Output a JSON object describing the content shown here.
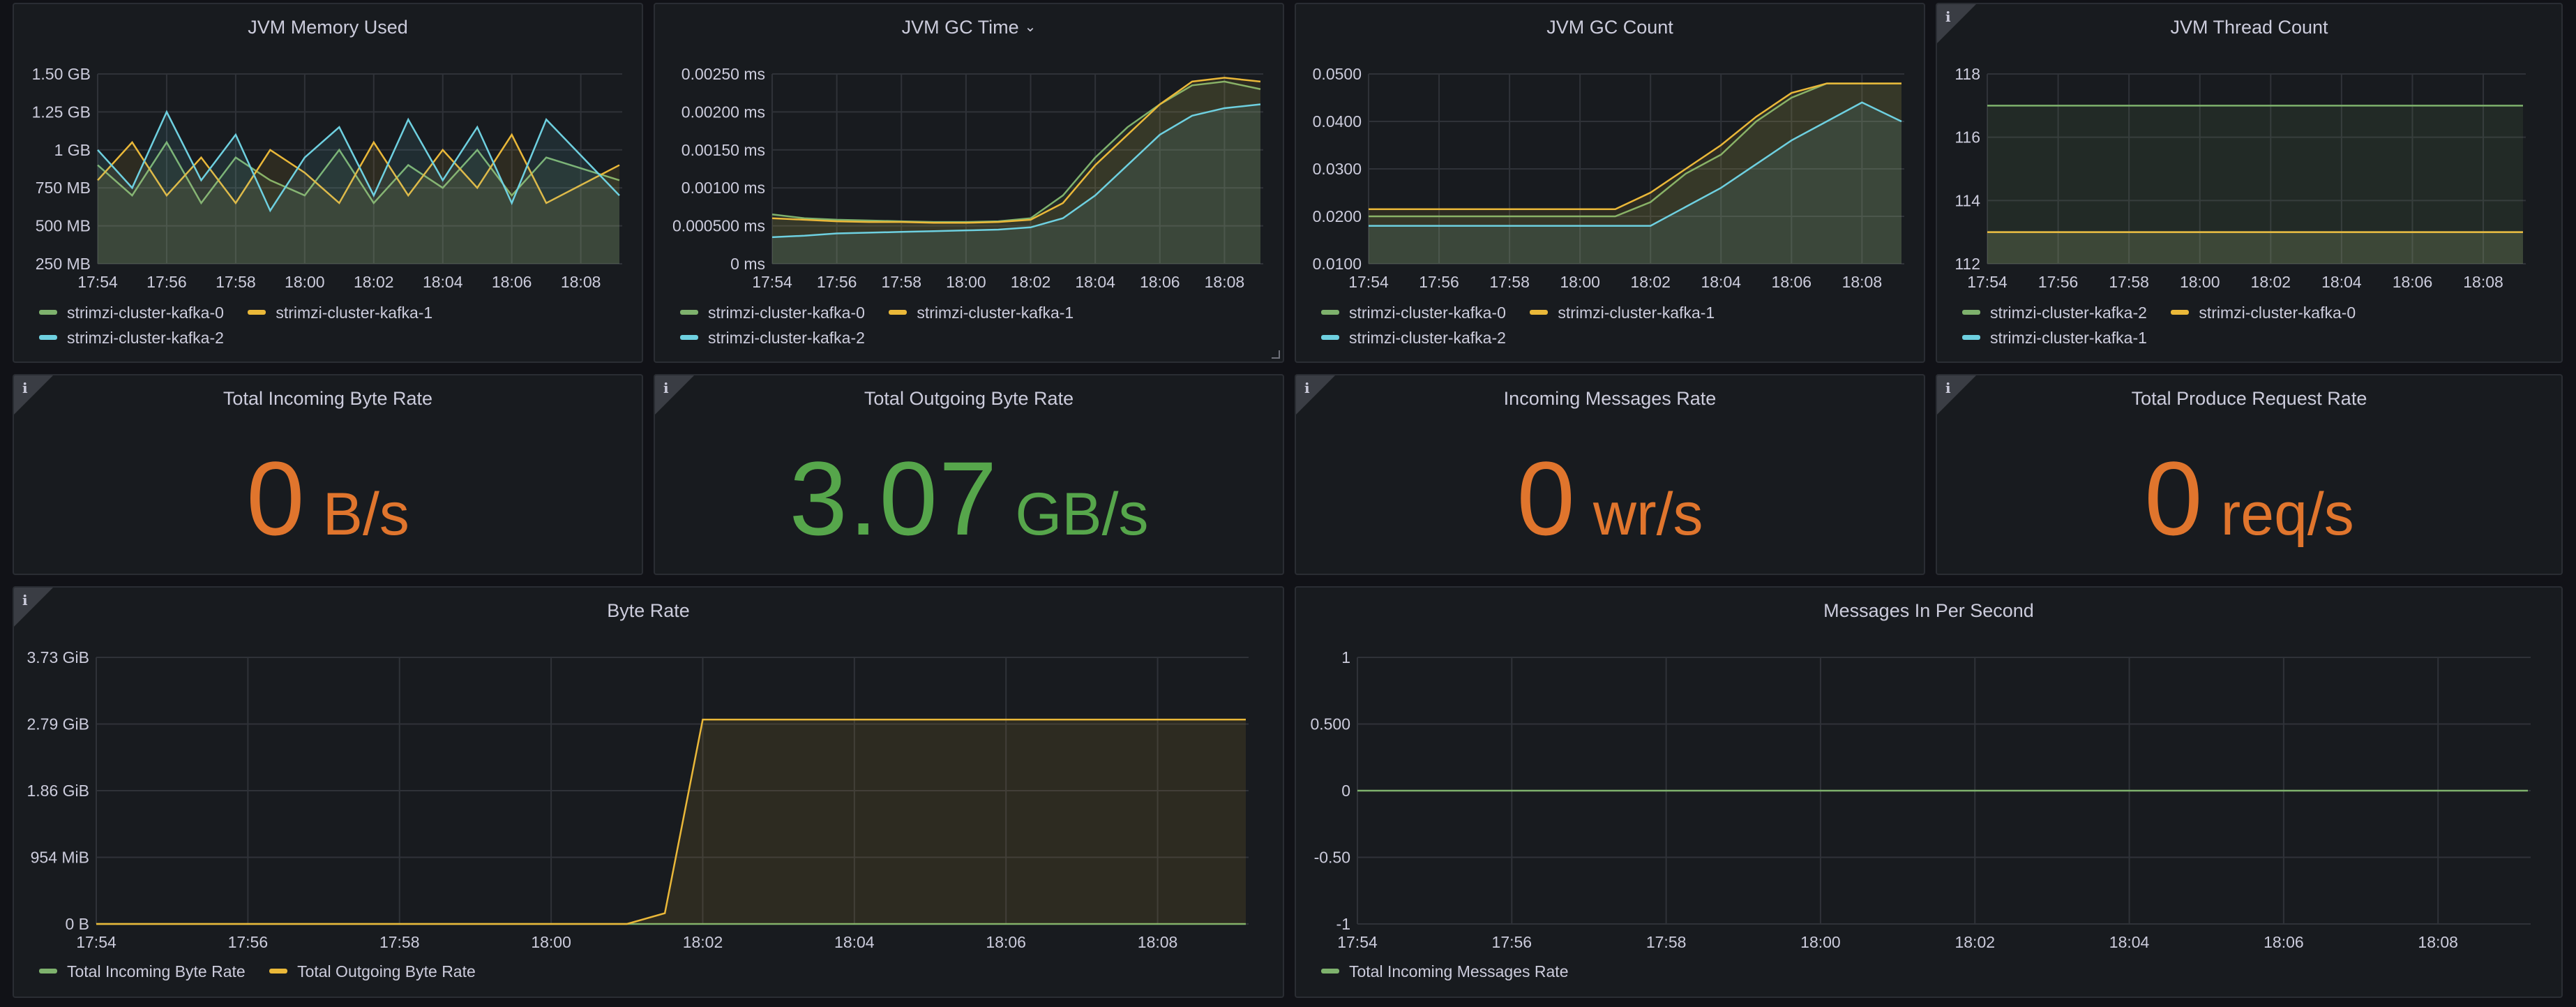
{
  "colors": {
    "green": "#7eb26d",
    "yellow": "#eab839",
    "blue": "#6ed0e0",
    "orange": "#e0752d",
    "stat_green": "#56a64b"
  },
  "panels": {
    "jvm_memory": {
      "title": "JVM Memory Used",
      "yticks": [
        "1.50 GB",
        "1.25 GB",
        "1 GB",
        "750 MB",
        "500 MB",
        "250 MB"
      ],
      "xticks": [
        "17:54",
        "17:56",
        "17:58",
        "18:00",
        "18:02",
        "18:04",
        "18:06",
        "18:08"
      ],
      "legend": [
        "strimzi-cluster-kafka-0",
        "strimzi-cluster-kafka-1",
        "strimzi-cluster-kafka-2"
      ]
    },
    "jvm_gc_time": {
      "title": "JVM GC Time",
      "yticks": [
        "0.00250 ms",
        "0.00200 ms",
        "0.00150 ms",
        "0.00100 ms",
        "0.000500 ms",
        "0 ms"
      ],
      "xticks": [
        "17:54",
        "17:56",
        "17:58",
        "18:00",
        "18:02",
        "18:04",
        "18:06",
        "18:08"
      ],
      "legend": [
        "strimzi-cluster-kafka-0",
        "strimzi-cluster-kafka-1",
        "strimzi-cluster-kafka-2"
      ]
    },
    "jvm_gc_count": {
      "title": "JVM GC Count",
      "yticks": [
        "0.0500",
        "0.0400",
        "0.0300",
        "0.0200",
        "0.0100"
      ],
      "xticks": [
        "17:54",
        "17:56",
        "17:58",
        "18:00",
        "18:02",
        "18:04",
        "18:06",
        "18:08"
      ],
      "legend": [
        "strimzi-cluster-kafka-0",
        "strimzi-cluster-kafka-1",
        "strimzi-cluster-kafka-2"
      ]
    },
    "jvm_thread_count": {
      "title": "JVM Thread Count",
      "yticks": [
        "118",
        "116",
        "114",
        "112"
      ],
      "xticks": [
        "17:54",
        "17:56",
        "17:58",
        "18:00",
        "18:02",
        "18:04",
        "18:06",
        "18:08"
      ],
      "legend": [
        "strimzi-cluster-kafka-2",
        "strimzi-cluster-kafka-0",
        "strimzi-cluster-kafka-1"
      ]
    },
    "total_incoming_byte_rate": {
      "title": "Total Incoming Byte Rate",
      "value": "0",
      "unit": "B/s"
    },
    "total_outgoing_byte_rate": {
      "title": "Total Outgoing Byte Rate",
      "value": "3.07",
      "unit": "GB/s"
    },
    "incoming_messages_rate": {
      "title": "Incoming Messages Rate",
      "value": "0",
      "unit": "wr/s"
    },
    "total_produce_request_rate": {
      "title": "Total Produce Request Rate",
      "value": "0",
      "unit": "req/s"
    },
    "byte_rate": {
      "title": "Byte Rate",
      "yticks": [
        "3.73 GiB",
        "2.79 GiB",
        "1.86 GiB",
        "954 MiB",
        "0 B"
      ],
      "xticks": [
        "17:54",
        "17:56",
        "17:58",
        "18:00",
        "18:02",
        "18:04",
        "18:06",
        "18:08"
      ],
      "legend": [
        "Total Incoming Byte Rate",
        "Total Outgoing Byte Rate"
      ]
    },
    "messages_in_per_second": {
      "title": "Messages In Per Second",
      "yticks": [
        "1",
        "0.500",
        "0",
        "-0.50",
        "-1"
      ],
      "xticks": [
        "17:54",
        "17:56",
        "17:58",
        "18:00",
        "18:02",
        "18:04",
        "18:06",
        "18:08"
      ],
      "legend": [
        "Total Incoming Messages Rate"
      ]
    }
  },
  "chart_data": [
    {
      "type": "line",
      "title": "JVM Memory Used",
      "x": [
        "17:54",
        "17:55",
        "17:56",
        "17:57",
        "17:58",
        "17:59",
        "18:00",
        "18:01",
        "18:02",
        "18:03",
        "18:04",
        "18:05",
        "18:06",
        "18:07",
        "18:08"
      ],
      "ylim": [
        250,
        1500
      ],
      "ylabel": "MB",
      "series": [
        {
          "name": "strimzi-cluster-kafka-0",
          "values": [
            900,
            700,
            1050,
            650,
            950,
            800,
            700,
            1000,
            650,
            900,
            750,
            1000,
            700,
            950,
            800
          ]
        },
        {
          "name": "strimzi-cluster-kafka-1",
          "values": [
            800,
            1050,
            700,
            950,
            650,
            1000,
            850,
            650,
            1050,
            700,
            1000,
            750,
            1100,
            650,
            900
          ]
        },
        {
          "name": "strimzi-cluster-kafka-2",
          "values": [
            1000,
            750,
            1250,
            800,
            1100,
            600,
            950,
            1150,
            700,
            1200,
            800,
            1150,
            650,
            1200,
            700
          ]
        }
      ]
    },
    {
      "type": "line",
      "title": "JVM GC Time",
      "x": [
        "17:54",
        "17:55",
        "17:56",
        "17:57",
        "17:58",
        "17:59",
        "18:00",
        "18:01",
        "18:02",
        "18:03",
        "18:04",
        "18:05",
        "18:06",
        "18:07",
        "18:08",
        "18:09"
      ],
      "ylim": [
        0,
        0.0025
      ],
      "series": [
        {
          "name": "strimzi-cluster-kafka-0",
          "values": [
            0.00065,
            0.0006,
            0.00058,
            0.00057,
            0.00056,
            0.00055,
            0.00055,
            0.00056,
            0.0006,
            0.0009,
            0.0014,
            0.0018,
            0.0021,
            0.00235,
            0.0024,
            0.0023
          ]
        },
        {
          "name": "strimzi-cluster-kafka-1",
          "values": [
            0.0006,
            0.00058,
            0.00056,
            0.00055,
            0.00055,
            0.00054,
            0.00054,
            0.00055,
            0.00058,
            0.0008,
            0.0013,
            0.0017,
            0.0021,
            0.0024,
            0.00245,
            0.0024
          ]
        },
        {
          "name": "strimzi-cluster-kafka-2",
          "values": [
            0.00035,
            0.00037,
            0.0004,
            0.00041,
            0.00042,
            0.00043,
            0.00044,
            0.00045,
            0.00048,
            0.0006,
            0.0009,
            0.0013,
            0.0017,
            0.00195,
            0.00205,
            0.0021
          ]
        }
      ]
    },
    {
      "type": "line",
      "title": "JVM GC Count",
      "x": [
        "17:54",
        "17:55",
        "17:56",
        "17:57",
        "17:58",
        "17:59",
        "18:00",
        "18:01",
        "18:02",
        "18:03",
        "18:04",
        "18:05",
        "18:06",
        "18:07",
        "18:08",
        "18:09"
      ],
      "ylim": [
        0.01,
        0.05
      ],
      "series": [
        {
          "name": "strimzi-cluster-kafka-0",
          "values": [
            0.02,
            0.02,
            0.02,
            0.02,
            0.02,
            0.02,
            0.02,
            0.02,
            0.023,
            0.029,
            0.033,
            0.04,
            0.045,
            0.048,
            0.048,
            0.048
          ]
        },
        {
          "name": "strimzi-cluster-kafka-1",
          "values": [
            0.0215,
            0.0215,
            0.0215,
            0.0215,
            0.0215,
            0.0215,
            0.0215,
            0.0215,
            0.025,
            0.03,
            0.035,
            0.041,
            0.046,
            0.048,
            0.048,
            0.048
          ]
        },
        {
          "name": "strimzi-cluster-kafka-2",
          "values": [
            0.018,
            0.018,
            0.018,
            0.018,
            0.018,
            0.018,
            0.018,
            0.018,
            0.018,
            0.022,
            0.026,
            0.031,
            0.036,
            0.04,
            0.044,
            0.04
          ]
        }
      ]
    },
    {
      "type": "line",
      "title": "JVM Thread Count",
      "x": [
        "17:54",
        "18:09"
      ],
      "ylim": [
        112,
        118
      ],
      "series": [
        {
          "name": "strimzi-cluster-kafka-2",
          "values": [
            113,
            113
          ]
        },
        {
          "name": "strimzi-cluster-kafka-0",
          "values": [
            117,
            117
          ]
        },
        {
          "name": "strimzi-cluster-kafka-1",
          "values": [
            113,
            113
          ]
        }
      ]
    },
    {
      "type": "line",
      "title": "Byte Rate",
      "x": [
        "17:54",
        "17:56",
        "17:58",
        "18:00",
        "18:01",
        "18:01.5",
        "18:02",
        "18:03",
        "18:04",
        "18:05",
        "18:06",
        "18:07",
        "18:08",
        "18:09"
      ],
      "ylim": [
        0,
        3.73
      ],
      "ylabel": "GiB",
      "series": [
        {
          "name": "Total Incoming Byte Rate",
          "values": [
            0,
            0,
            0,
            0,
            0,
            0,
            0,
            0,
            0,
            0,
            0,
            0,
            0,
            0
          ]
        },
        {
          "name": "Total Outgoing Byte Rate",
          "values": [
            0,
            0,
            0,
            0,
            0,
            0.15,
            2.86,
            2.86,
            2.86,
            2.86,
            2.86,
            2.86,
            2.86,
            2.86
          ]
        }
      ]
    },
    {
      "type": "line",
      "title": "Messages In Per Second",
      "x": [
        "17:54",
        "18:09"
      ],
      "ylim": [
        -1,
        1
      ],
      "series": [
        {
          "name": "Total Incoming Messages Rate",
          "values": [
            0,
            0
          ]
        }
      ]
    }
  ]
}
